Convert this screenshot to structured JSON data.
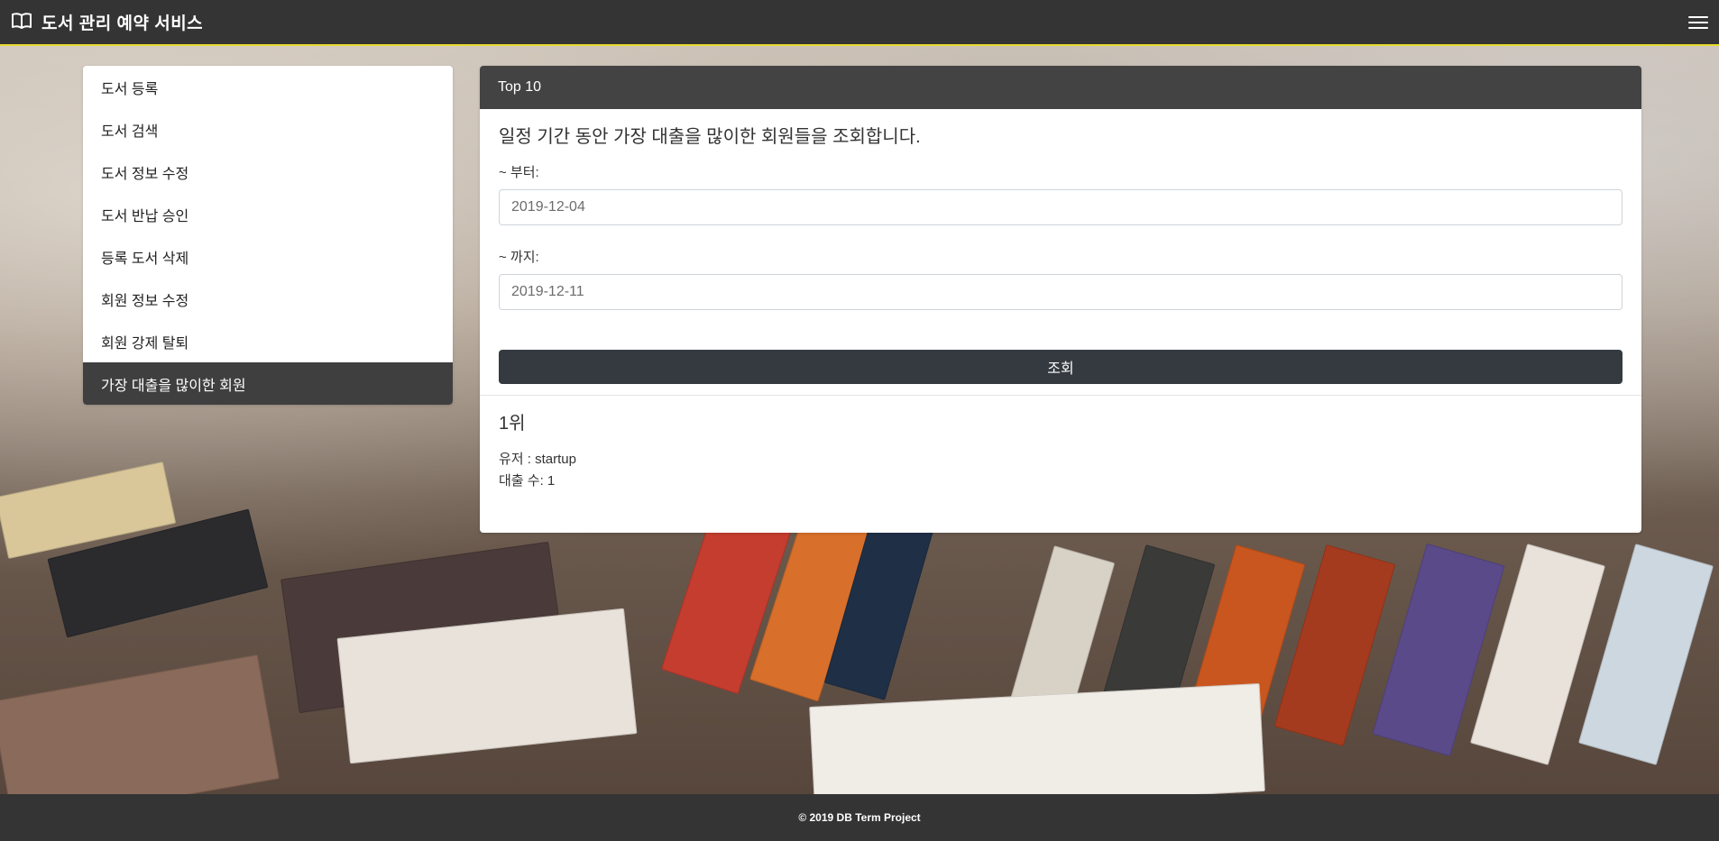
{
  "header": {
    "title": "도서 관리 예약 서비스",
    "logo_icon": "book-open-icon",
    "menu_icon": "hamburger-menu-icon",
    "accent_color": "#e6db2e"
  },
  "sidebar": {
    "items": [
      {
        "label": "도서 등록",
        "active": false
      },
      {
        "label": "도서 검색",
        "active": false
      },
      {
        "label": "도서 정보 수정",
        "active": false
      },
      {
        "label": "도서 반납 승인",
        "active": false
      },
      {
        "label": "등록 도서 삭제",
        "active": false
      },
      {
        "label": "회원 정보 수정",
        "active": false
      },
      {
        "label": "회원 강제 탈퇴",
        "active": false
      },
      {
        "label": "가장 대출을 많이한 회원",
        "active": true
      }
    ]
  },
  "main": {
    "card_title": "Top 10",
    "description": "일정 기간 동안 가장 대출을 많이한 회원들을 조회합니다.",
    "from_label": "~ 부터:",
    "from_value": "2019-12-04",
    "to_label": "~ 까지:",
    "to_value": "2019-12-11",
    "submit_label": "조회",
    "results": [
      {
        "rank": "1위",
        "user_line": "유저 : startup",
        "count_line": "대출 수: 1"
      }
    ]
  },
  "footer": {
    "text": "© 2019 DB Term Project"
  }
}
